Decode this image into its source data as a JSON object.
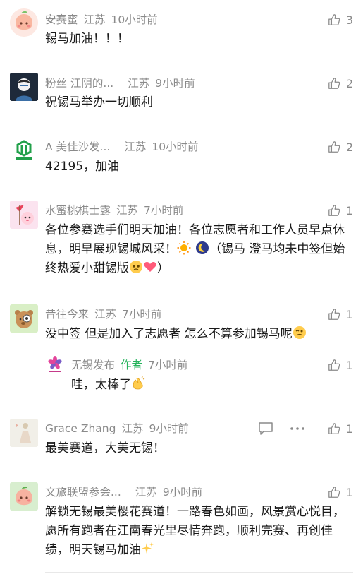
{
  "comments": [
    {
      "user": "安赛蜜",
      "location": "江苏",
      "time": "10小时前",
      "likes": "3",
      "text": "锡马加油！！！"
    },
    {
      "user": "粉丝 江阴的...",
      "location": "江苏",
      "time": "9小时前",
      "likes": "2",
      "text": "祝锡马举办一切顺利"
    },
    {
      "user": "A  美佳沙发...",
      "location": "江苏",
      "time": "10小时前",
      "likes": "2",
      "text": "42195，加油"
    },
    {
      "user": "水蜜桃棋士露",
      "location": "江苏",
      "time": "7小时前",
      "likes": "1",
      "text_a": "各位参赛选手们明天加油！各位志愿者和工作人员早点休息，明早展现锡城风采！",
      "text_b": "（锡马 澄马均未中签但始终热爱小甜锡版",
      "text_c": "）"
    },
    {
      "user": "昔往今来",
      "location": "江苏",
      "time": "7小时前",
      "likes": "1",
      "text": "没中签 但是加入了志愿者 怎么不算参加锡马呢"
    },
    {
      "user": "无锡发布",
      "author_badge": "作者",
      "time": "7小时前",
      "likes": "1",
      "text": "哇，太棒了"
    },
    {
      "user": "Grace Zhang",
      "location": "江苏",
      "time": "9小时前",
      "likes": "1",
      "text": "最美赛道，大美无锡！"
    },
    {
      "user": "文旅联盟参会...",
      "location": "江苏",
      "time": "9小时前",
      "likes": "1",
      "text": "解锁无锡最美樱花赛道！一路春色如画，风景赏心悦目，愿所有跑者在江南春光里尽情奔跑，顺利完赛、再创佳绩，明天锡马加油"
    }
  ],
  "icons": {
    "like": "thumbs-up-icon",
    "reply": "comment-bubble-icon",
    "more": "more-dots-icon"
  },
  "colors": {
    "meta": "#8a8a8a",
    "author": "#24b35b",
    "text": "#1a1a1a"
  }
}
